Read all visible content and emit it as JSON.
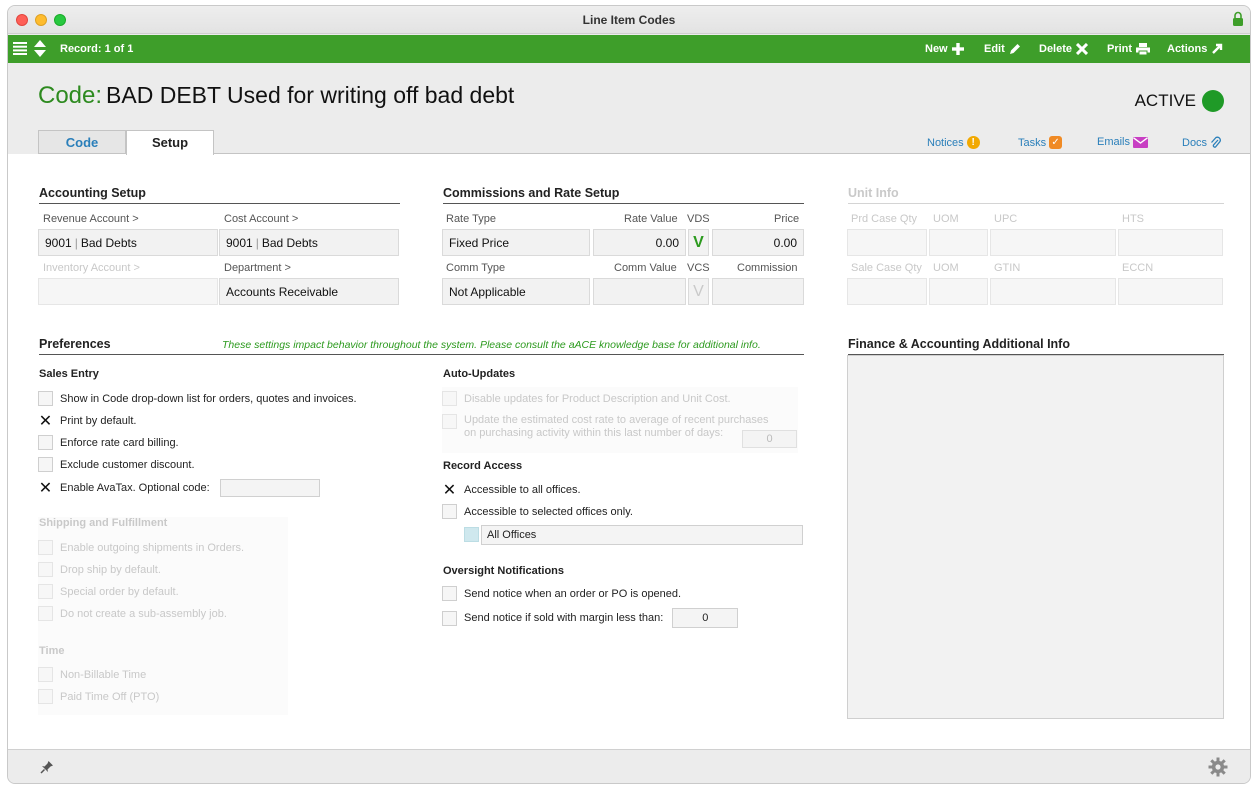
{
  "window": {
    "title": "Line Item Codes"
  },
  "toolbar": {
    "record_label": "Record: 1 of 1",
    "new_label": "New",
    "edit_label": "Edit",
    "delete_label": "Delete",
    "print_label": "Print",
    "actions_label": "Actions"
  },
  "header": {
    "code_prefix": "Code:",
    "code_value": "BAD DEBT Used for writing off bad debt",
    "status": "ACTIVE",
    "status_color": "#1f9a27"
  },
  "tabs": [
    {
      "label": "Code"
    },
    {
      "label": "Setup"
    }
  ],
  "links": {
    "notices": "Notices",
    "tasks": "Tasks",
    "emails": "Emails",
    "docs": "Docs"
  },
  "accounting": {
    "title": "Accounting Setup",
    "revenue_label": "Revenue Account >",
    "revenue_num": "9001",
    "revenue_name": "Bad Debts",
    "cost_label": "Cost Account >",
    "cost_num": "9001",
    "cost_name": "Bad Debts",
    "inventory_label": "Inventory Account >",
    "department_label": "Department >",
    "department_value": "Accounts Receivable"
  },
  "commissions": {
    "title": "Commissions and Rate Setup",
    "rate_type_label": "Rate Type",
    "rate_value_label": "Rate Value",
    "vds_label": "VDS",
    "price_label": "Price",
    "rate_type_value": "Fixed Price",
    "rate_value": "0.00",
    "vds_mark": "V",
    "price_value": "0.00",
    "comm_type_label": "Comm Type",
    "comm_value_label": "Comm Value",
    "vcs_label": "VCS",
    "commission_label": "Commission",
    "comm_type_value": "Not Applicable",
    "vcs_mark": "V"
  },
  "unit_info": {
    "title": "Unit Info",
    "prd_case_qty": "Prd Case Qty",
    "uom1": "UOM",
    "upc": "UPC",
    "hts": "HTS",
    "sale_case_qty": "Sale Case Qty",
    "uom2": "UOM",
    "gtin": "GTIN",
    "eccn": "ECCN"
  },
  "preferences": {
    "title": "Preferences",
    "note": "These settings impact behavior throughout the system. Please consult the aACE knowledge base for additional info.",
    "sales_entry": "Sales Entry",
    "sales_items": [
      "Show in Code drop-down list for orders, quotes and invoices.",
      "Print by default.",
      "Enforce rate card billing.",
      "Exclude customer discount.",
      "Enable AvaTax. Optional code:"
    ],
    "shipping_title": "Shipping and Fulfillment",
    "shipping_items": [
      "Enable outgoing shipments in Orders.",
      "Drop ship by default.",
      "Special order by default.",
      "Do not create a sub-assembly job."
    ],
    "time_title": "Time",
    "time_items": [
      "Non-Billable Time",
      "Paid Time Off (PTO)"
    ],
    "auto_updates_title": "Auto-Updates",
    "auto_item1": "Disable updates for Product Description and Unit Cost.",
    "auto_item2a": "Update the estimated cost rate to average of recent purchases",
    "auto_item2b": "on purchasing activity within this last number of days:",
    "auto_days": "0",
    "record_access_title": "Record Access",
    "access_all": "Accessible to all offices.",
    "access_selected": "Accessible to selected offices only.",
    "offices_value": "All Offices",
    "oversight_title": "Oversight Notifications",
    "oversight_item1": "Send notice when an order or PO is opened.",
    "oversight_item2": "Send notice if sold with margin less than:",
    "margin_value": "0"
  },
  "finance": {
    "title": "Finance & Accounting Additional Info"
  }
}
